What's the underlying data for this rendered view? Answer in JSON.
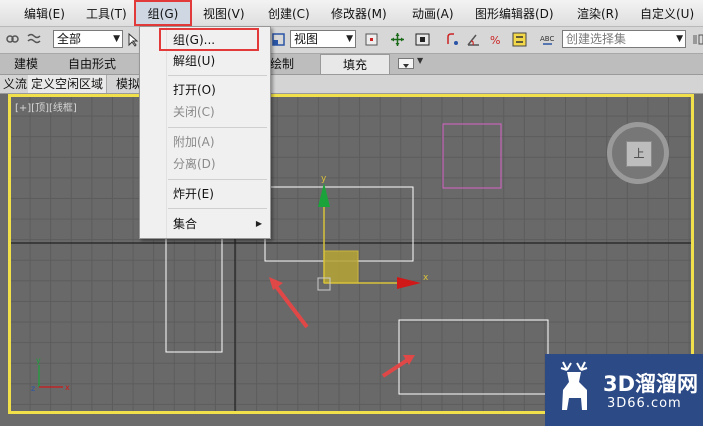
{
  "menubar": {
    "items": [
      {
        "label": "编辑(E)"
      },
      {
        "label": "工具(T)"
      },
      {
        "label": "组(G)"
      },
      {
        "label": "视图(V)"
      },
      {
        "label": "创建(C)"
      },
      {
        "label": "修改器(M)"
      },
      {
        "label": "动画(A)"
      },
      {
        "label": "图形编辑器(D)"
      },
      {
        "label": "渲染(R)"
      },
      {
        "label": "自定义(U)"
      }
    ]
  },
  "toolbar": {
    "selection_filter": "全部",
    "reference_coord": "视图",
    "named_selection_placeholder": "创建选择集"
  },
  "ribbon": {
    "tabs": [
      "建模",
      "自由形式",
      "绘制",
      "填充"
    ]
  },
  "subtabs": {
    "items": [
      "义流",
      "定义空闲区域",
      "模拟"
    ]
  },
  "viewport": {
    "label": "[+][顶][线框]",
    "navcube_face": "上"
  },
  "group_menu": {
    "items": [
      {
        "label": "组(G)...",
        "enabled": true
      },
      {
        "label": "解组(U)",
        "enabled": true
      },
      {
        "label": "打开(O)",
        "enabled": true
      },
      {
        "label": "关闭(C)",
        "enabled": false
      },
      {
        "label": "附加(A)",
        "enabled": false
      },
      {
        "label": "分离(D)",
        "enabled": false
      },
      {
        "label": "炸开(E)",
        "enabled": true
      },
      {
        "label": "集合",
        "enabled": true
      }
    ]
  },
  "watermark": {
    "title": "3D溜溜网",
    "url": "3D66.com"
  },
  "colors": {
    "highlight": "#e23a3a",
    "viewport_border": "#f1e04a",
    "gizmo_y": "#1aa33a",
    "gizmo_x": "#d01818",
    "gizmo_plane": "#d9c23a"
  }
}
